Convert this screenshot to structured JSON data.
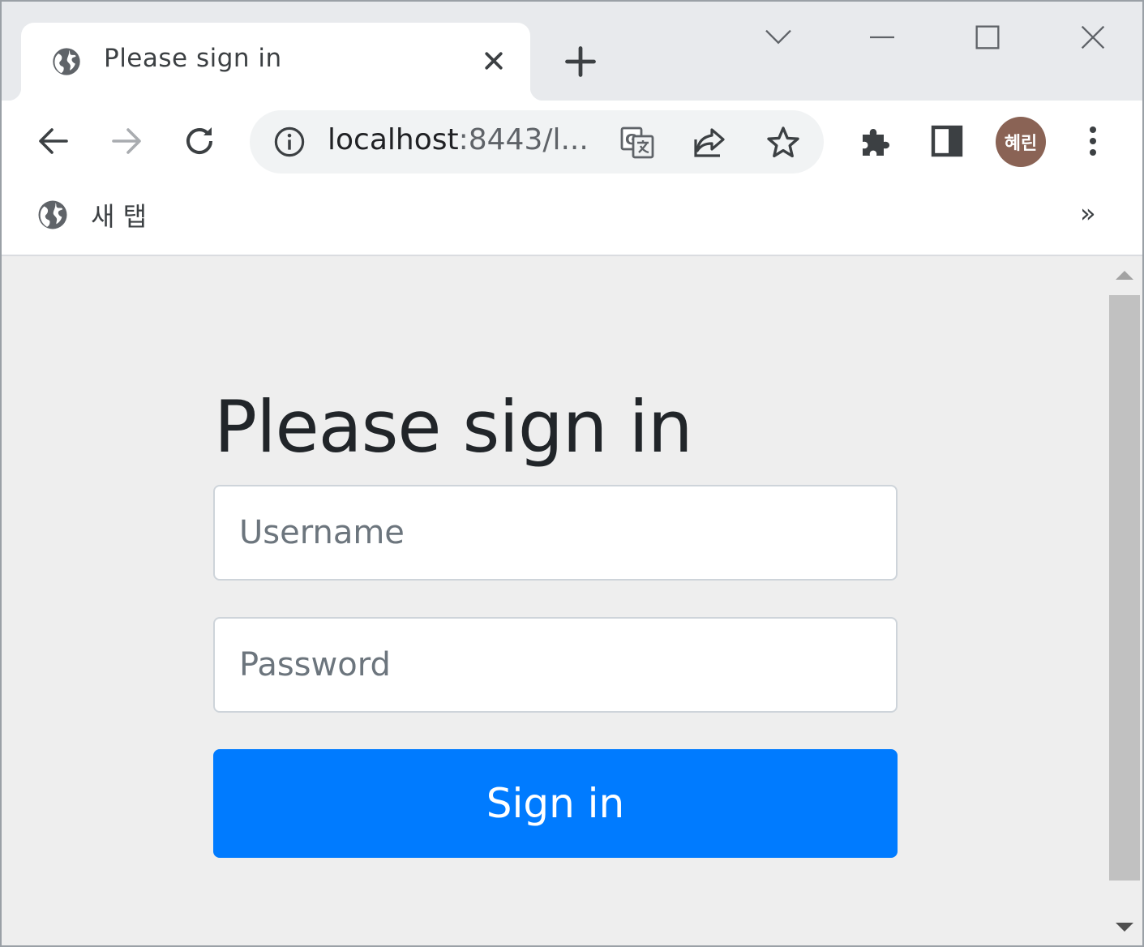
{
  "tab": {
    "title": "Please sign in",
    "favicon": "globe-icon",
    "close_icon": "close-icon"
  },
  "window_controls": [
    "chevron-down-icon",
    "minimize-icon",
    "maximize-icon",
    "close-icon"
  ],
  "toolbar": {
    "back_icon": "arrow-left-icon",
    "forward_icon": "arrow-right-icon",
    "reload_icon": "reload-icon",
    "url": "localhost:8443/l...",
    "url_host": "localhost",
    "url_rest": ":8443/l...",
    "translate_icon": "translate-icon",
    "share_icon": "share-icon",
    "bookmark_icon": "star-icon",
    "extensions_icon": "puzzle-icon",
    "side_panel_icon": "side-panel-icon",
    "profile_initials": "혜린",
    "menu_icon": "more-vert-icon"
  },
  "bookmarks": {
    "items": [
      {
        "label": "새 탭",
        "icon": "globe-icon"
      }
    ],
    "overflow": "»"
  },
  "page": {
    "heading": "Please sign in",
    "username_placeholder": "Username",
    "password_placeholder": "Password",
    "submit_label": "Sign in"
  },
  "colors": {
    "primary_button": "#007bff",
    "page_background": "#eeeeee",
    "avatar": "#8a6355"
  }
}
